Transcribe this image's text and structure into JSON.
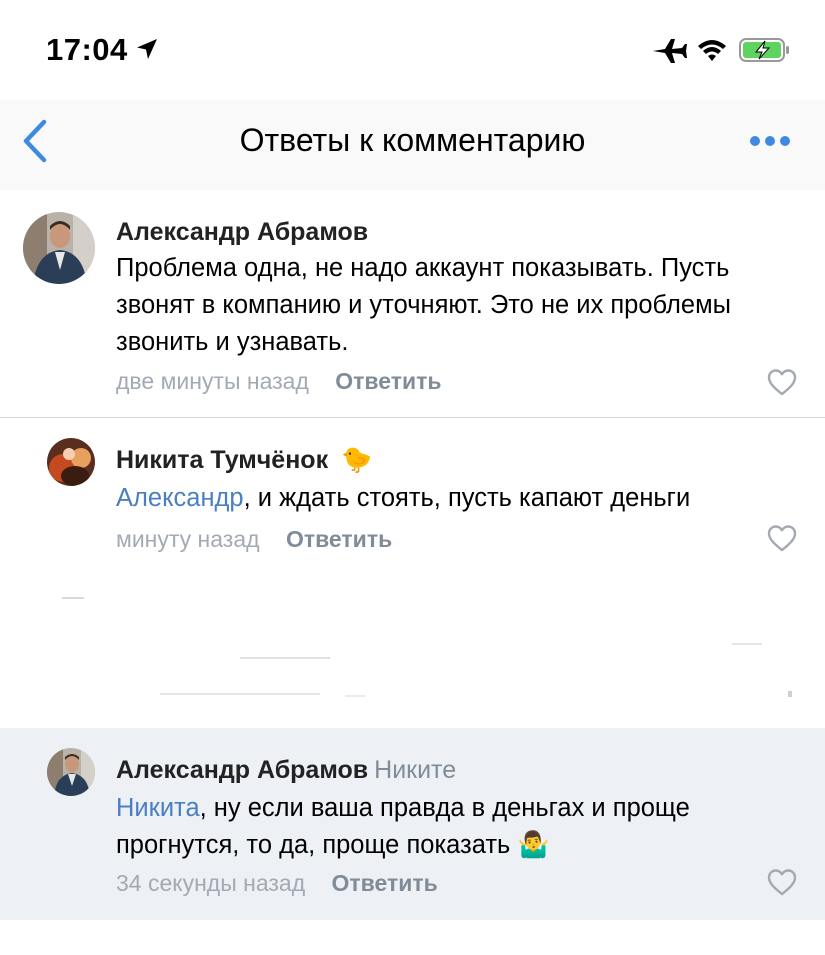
{
  "status_bar": {
    "time": "17:04",
    "icons": [
      "location-arrow-icon",
      "airplane-icon",
      "wifi-icon",
      "battery-charging-icon"
    ],
    "battery_color": "#5fd35f"
  },
  "nav": {
    "title": "Ответы к комментарию",
    "back_icon": "chevron-left-icon",
    "more_icon": "more-dots-icon",
    "accent": "#3f8ae0"
  },
  "comments": [
    {
      "author": "Александр Абрамов",
      "text": "Проблема одна, не надо аккаунт показывать. Пусть звонят в компанию и уточняют. Это не их проблемы звонить и узнавать.",
      "time": "две минуты назад",
      "reply_label": "Ответить"
    },
    {
      "author": "Никита Тумчёнок",
      "author_emoji": "🐤",
      "mention": "Александр",
      "text": ", и ждать стоять, пусть капают деньги",
      "time": "минуту назад",
      "reply_label": "Ответить"
    },
    {
      "author": "Александр Абрамов",
      "reply_to": "Никите",
      "mention": "Никита",
      "text": ", ну если ваша правда в деньгах и проще прогнутся, то да, проще показать",
      "text_emoji": "🤷‍♂️",
      "time": "34 секунды назад",
      "reply_label": "Ответить",
      "highlighted": true
    }
  ],
  "colors": {
    "mention": "#4a7fc1",
    "meta": "#a3aab3",
    "highlight_bg": "#edf0f5"
  }
}
